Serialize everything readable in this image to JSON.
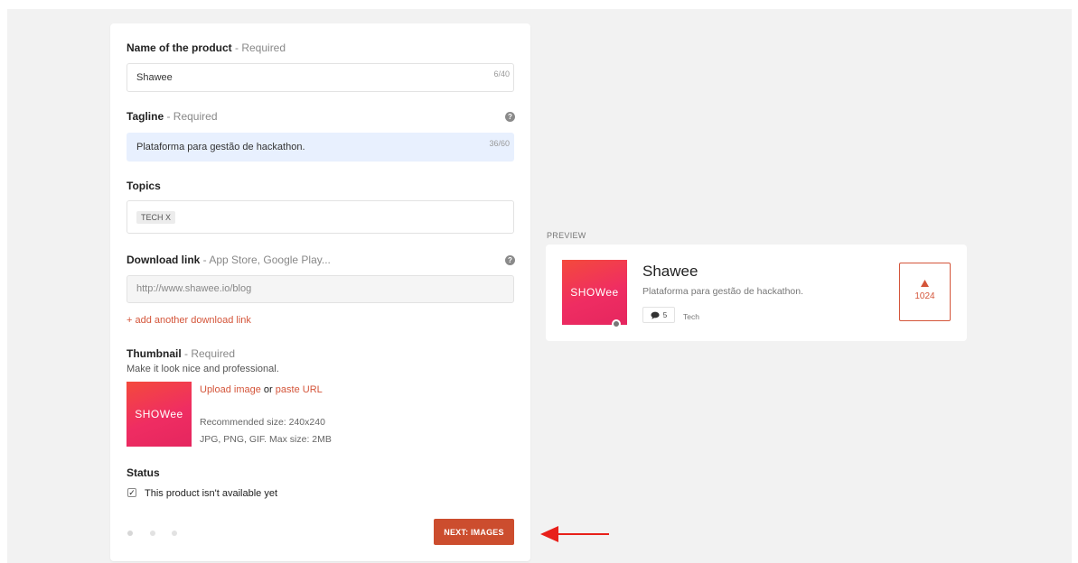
{
  "form": {
    "name": {
      "label": "Name of the product",
      "hint": " - Required",
      "value": "Shawee",
      "counter": "6/40"
    },
    "tagline": {
      "label": "Tagline",
      "hint": " - Required",
      "value": "Plataforma para gestão de hackathon.",
      "counter": "36/60"
    },
    "topics": {
      "label": "Topics",
      "tag": "TECH X"
    },
    "download": {
      "label": "Download link",
      "hint": " - App Store, Google Play...",
      "placeholder": "http://www.shawee.io/blog",
      "add_link": "+ add another download link"
    },
    "thumbnail": {
      "label": "Thumbnail",
      "hint": " - Required",
      "subtitle": "Make it look nice and professional.",
      "logo_text": "SHOWee",
      "upload_label": "Upload image",
      "or_text": " or ",
      "paste_label": "paste URL",
      "recommended": "Recommended size: 240x240",
      "formats": "JPG, PNG, GIF. Max size: 2MB"
    },
    "status": {
      "label": "Status",
      "checkbox_label": "This product isn't available yet",
      "checked": true
    },
    "next_button": "NEXT: IMAGES",
    "steps": {
      "current": 1,
      "total": 3
    }
  },
  "preview": {
    "label": "PREVIEW",
    "title": "Shawee",
    "tagline": "Plataforma para gestão de hackathon.",
    "logo_text": "SHOWee",
    "comments": "5",
    "topic": "Tech",
    "votes": "1024"
  },
  "colors": {
    "accent": "#cc4d2e",
    "link": "#d4553a",
    "arrow": "#e8201a",
    "brand_gradient_start": "#f44a3c",
    "brand_gradient_end": "#e5265f"
  },
  "icons": [
    "help-icon",
    "comment-icon",
    "upvote-icon",
    "arrow-left-icon",
    "checkbox-checked-icon"
  ]
}
